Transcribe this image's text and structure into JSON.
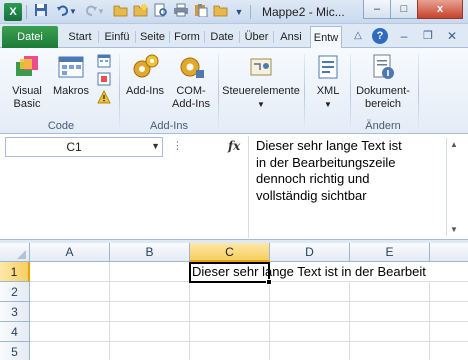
{
  "window": {
    "title": "Mappe2 - Mic...",
    "app_logo": "X",
    "buttons": {
      "minimize": "–",
      "maximize": "□",
      "close": "x"
    }
  },
  "qat": {
    "icons": [
      "save-icon",
      "undo-icon",
      "redo-icon",
      "open-folder-icon",
      "new-folder-icon",
      "print-preview-icon",
      "print-icon",
      "paste-icon",
      "open-icon",
      "customize-icon"
    ]
  },
  "tabs": [
    {
      "label": "Datei"
    },
    {
      "label": "Start"
    },
    {
      "label": "Einfü"
    },
    {
      "label": "Seite"
    },
    {
      "label": "Form"
    },
    {
      "label": "Date"
    },
    {
      "label": "Über"
    },
    {
      "label": "Ansi"
    },
    {
      "label": "Entw"
    }
  ],
  "active_tab": "Entw",
  "ribbon": {
    "groups": [
      {
        "label": "Code",
        "buttons": [
          {
            "label": "Visual\nBasic",
            "icon": "visual-basic-icon"
          },
          {
            "label": "Makros",
            "icon": "macros-icon"
          }
        ]
      },
      {
        "label": "Add-Ins",
        "buttons": [
          {
            "label": "Add-Ins",
            "icon": "add-ins-icon"
          },
          {
            "label": "COM-\nAdd-Ins",
            "icon": "com-add-ins-icon"
          }
        ]
      },
      {
        "label": "",
        "buttons": [
          {
            "label": "Steuerelemente",
            "icon": "controls-icon"
          }
        ]
      },
      {
        "label": "",
        "buttons": [
          {
            "label": "XML",
            "icon": "xml-icon"
          }
        ]
      },
      {
        "label": "Ändern",
        "buttons": [
          {
            "label": "Dokument-\nbereich",
            "icon": "document-panel-icon"
          }
        ]
      }
    ]
  },
  "formula_bar": {
    "name_box": "C1",
    "fx": "fx",
    "content": "Dieser sehr lange Text ist\nin der Bearbeitungszeile\ndennoch richtig und\nvollständig sichtbar"
  },
  "sheet": {
    "columns": [
      "A",
      "B",
      "C",
      "D",
      "E"
    ],
    "selected_column": "C",
    "rows": [
      "1",
      "2",
      "3",
      "4",
      "5"
    ],
    "selected_row": "1",
    "active_cell": "C1",
    "cell_C1_display": "Dieser sehr lange Text ist in der Bearbeit"
  }
}
